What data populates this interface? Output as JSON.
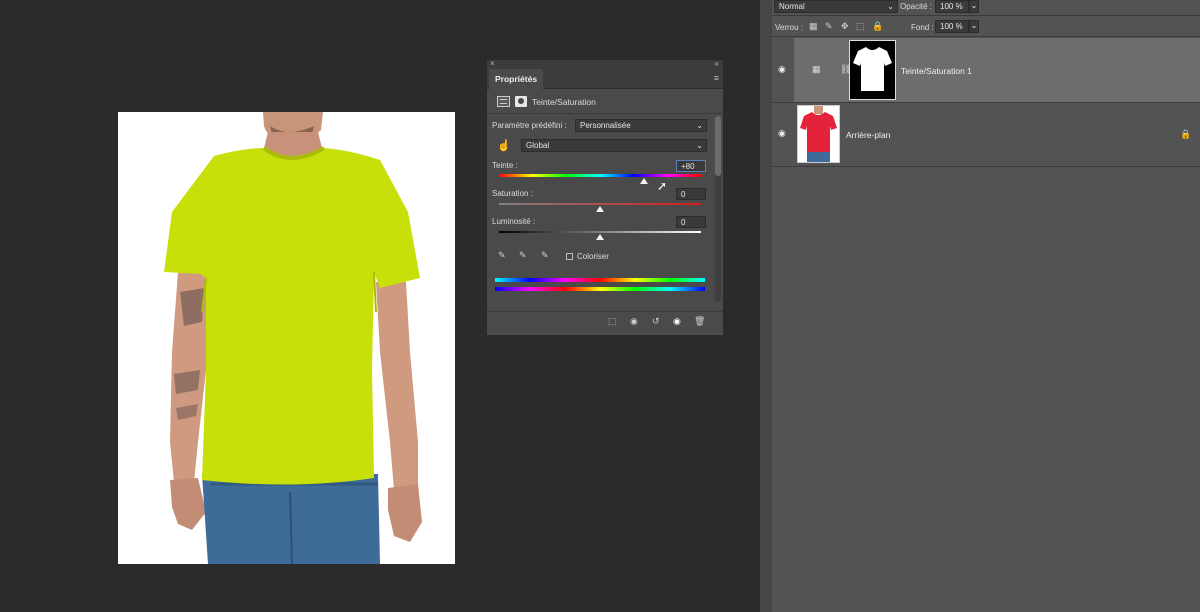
{
  "properties_panel": {
    "tab_label": "Propriétés",
    "adjustment_name": "Teinte/Saturation",
    "preset_label": "Paramètre prédéfini :",
    "preset_value": "Personnalisée",
    "channel_value": "Global",
    "hue_label": "Teinte :",
    "hue_value": "+80",
    "saturation_label": "Saturation :",
    "saturation_value": "0",
    "lightness_label": "Luminosité :",
    "lightness_value": "0",
    "colorize_label": "Coloriser",
    "hue_slider_fraction": 0.72,
    "saturation_slider_fraction": 0.5,
    "lightness_slider_fraction": 0.5
  },
  "layers_panel": {
    "blend_mode": "Normal",
    "opacity_label": "Opacité :",
    "opacity_value": "100 %",
    "lock_label": "Verrou :",
    "fill_label": "Fond :",
    "fill_value": "100 %",
    "layers": [
      {
        "name": "Teinte/Saturation 1",
        "selected": true
      },
      {
        "name": "Arrière-plan",
        "selected": false
      }
    ]
  },
  "colors": {
    "app_bg": "#2b2b2b",
    "panel_bg": "#535353",
    "shirt_recolored": "#c8e00a",
    "shirt_original": "#e4233a",
    "jeans": "#3e6b98"
  }
}
